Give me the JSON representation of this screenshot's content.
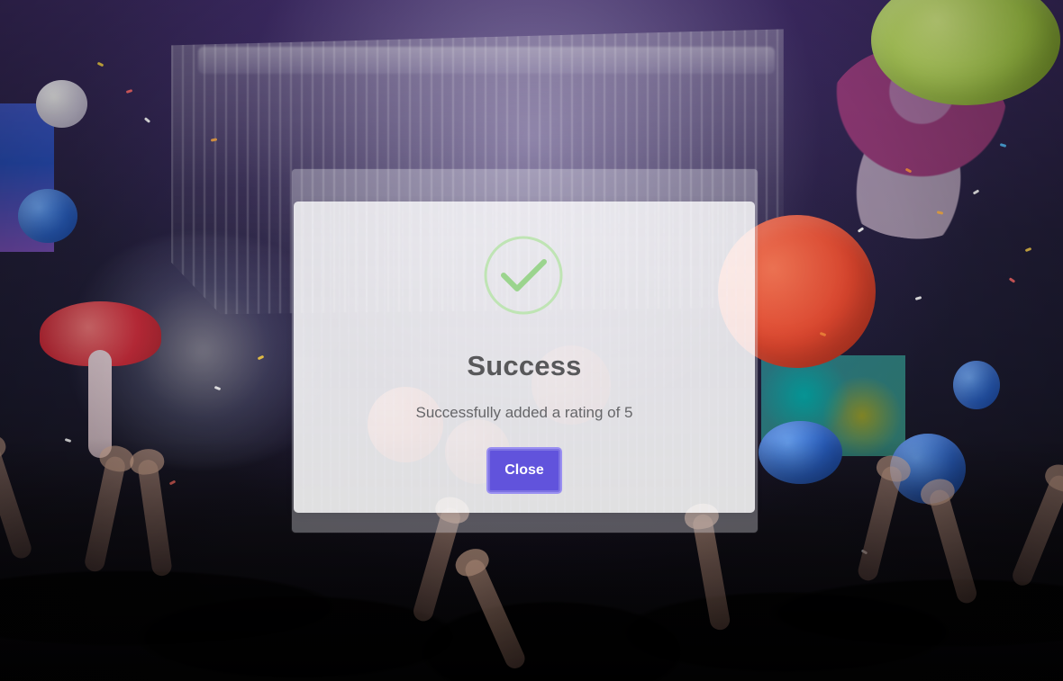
{
  "modal": {
    "title": "Success",
    "message": "Successfully added a rating of 5",
    "close_label": "Close",
    "icon": "check-icon"
  },
  "colors": {
    "success_green": "#9bd48e",
    "button_purple": "#6153dc"
  }
}
